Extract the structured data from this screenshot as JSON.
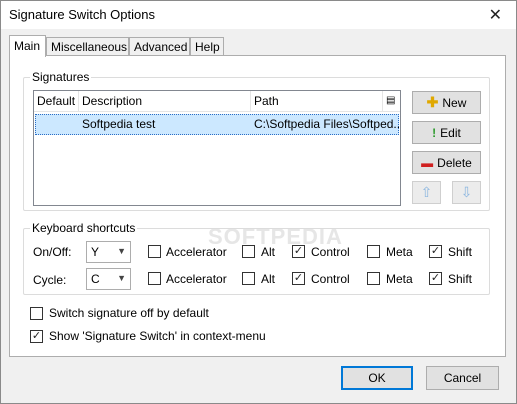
{
  "window": {
    "title": "Signature Switch Options"
  },
  "tabs": [
    {
      "label": "Main"
    },
    {
      "label": "Miscellaneous"
    },
    {
      "label": "Advanced"
    },
    {
      "label": "Help"
    }
  ],
  "signatures": {
    "group_label": "Signatures",
    "columns": [
      "Default",
      "Description",
      "Path"
    ],
    "rows": [
      {
        "default": "",
        "description": "Softpedia test",
        "path": "C:\\Softpedia Files\\Softped..."
      }
    ],
    "buttons": {
      "new_label": "New",
      "edit_label": "Edit",
      "delete_label": "Delete",
      "move_up_icon": "arrow-up-icon",
      "move_down_icon": "arrow-down-icon"
    }
  },
  "shortcuts": {
    "group_label": "Keyboard shortcuts",
    "rows": [
      {
        "label": "On/Off:",
        "key": "Y",
        "accelerator": false,
        "alt": false,
        "control": true,
        "meta": false,
        "shift": true
      },
      {
        "label": "Cycle:",
        "key": "C",
        "accelerator": false,
        "alt": false,
        "control": true,
        "meta": false,
        "shift": true
      }
    ],
    "modifier_labels": {
      "accelerator": "Accelerator",
      "alt": "Alt",
      "control": "Control",
      "meta": "Meta",
      "shift": "Shift"
    }
  },
  "options": [
    {
      "label": "Switch signature off by default",
      "checked": false
    },
    {
      "label": "Show 'Signature Switch' in context-menu",
      "checked": true
    }
  ],
  "footer": {
    "ok_label": "OK",
    "cancel_label": "Cancel"
  },
  "watermark": "SOFTPEDIA",
  "colors": {
    "selection": "#cce8ff",
    "focus": "#0078d7"
  }
}
